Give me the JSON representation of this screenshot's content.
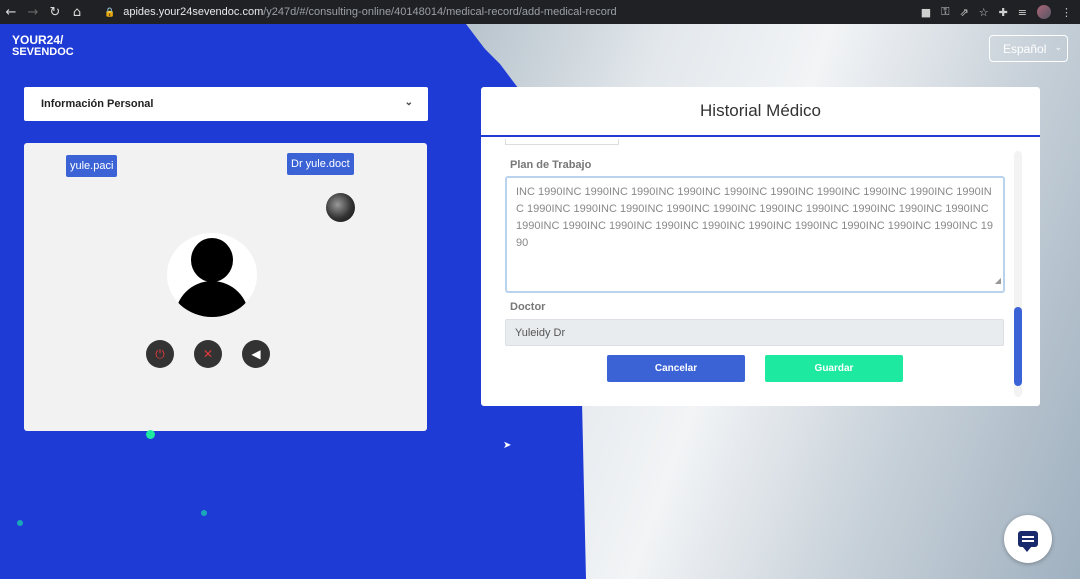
{
  "browser": {
    "url_host": "apides.your24sevendoc.com",
    "url_path": "/y247d/#/consulting-online/40148014/medical-record/add-medical-record"
  },
  "logo": {
    "line1": "YOUR24/",
    "line2": "SEVENDOC"
  },
  "language": {
    "selected": "Español"
  },
  "info_panel": {
    "title": "Información Personal"
  },
  "video": {
    "patient_tag": "yule.paci",
    "doctor_tag": "Dr yule.doct"
  },
  "modal": {
    "title": "Historial Médico",
    "plan_label": "Plan de Trabajo",
    "plan_value": "INC 1990INC 1990INC 1990INC 1990INC 1990INC 1990INC 1990INC 1990INC 1990INC 1990INC 1990INC 1990INC 1990INC 1990INC 1990INC 1990INC 1990INC 1990INC 1990INC 1990INC 1990INC 1990INC 1990INC 1990INC 1990INC 1990INC 1990INC 1990INC 1990INC 1990INC 1990",
    "doctor_label": "Doctor",
    "doctor_value": "Yuleidy Dr",
    "cancel_label": "Cancelar",
    "save_label": "Guardar"
  },
  "colors": {
    "primary_blue": "#1f3bd6",
    "button_blue": "#3b63d6",
    "save_green": "#1de9a0",
    "end_call_red": "#e03a3a"
  },
  "icons": [
    "back-icon",
    "forward-icon",
    "reload-icon",
    "home-icon",
    "lock-icon",
    "camera-icon",
    "key-icon",
    "share-icon",
    "star-icon",
    "extensions-icon",
    "media-icon",
    "profile-icon",
    "menu-icon",
    "chevron-down-icon",
    "power-icon",
    "mic-off-icon",
    "volume-icon",
    "chat-icon"
  ]
}
